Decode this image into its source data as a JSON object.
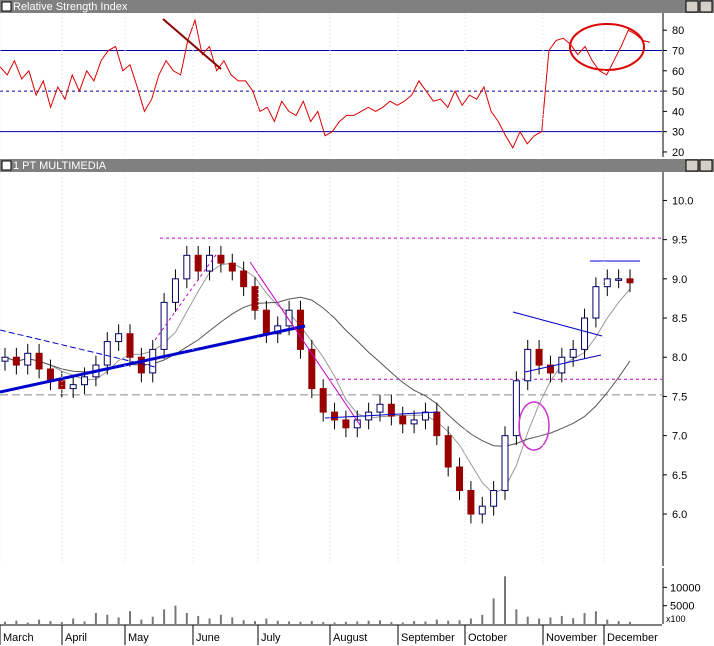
{
  "panels": {
    "rsi_title": "Relative Strength Index",
    "price_title": "1 PT MULTIMEDIA",
    "volume_multiplier": "x100"
  },
  "colors": {
    "title_bar": "#808080",
    "rsi_line": "#dd0000",
    "reference_line": "#0000aa",
    "up_candle": "#ffffff",
    "down_candle": "#990000",
    "trendline_blue": "#0000cc",
    "trendline_magenta": "#cc00cc",
    "ma_short": "#999999",
    "ma_long": "#555555",
    "annotation_red": "#dd0000",
    "annotation_purple": "#cc33cc",
    "volume_bar": "#777777"
  },
  "chart_data": [
    {
      "type": "line",
      "panel": "rsi",
      "title": "Relative Strength Index",
      "ylim": [
        18,
        88
      ],
      "yticks": [
        20,
        30,
        40,
        50,
        60,
        70,
        80
      ],
      "reference_levels": [
        30,
        50,
        70
      ],
      "series": [
        {
          "values": [
            62,
            58,
            65,
            56,
            60,
            48,
            55,
            42,
            52,
            46,
            58,
            50,
            60,
            55,
            65,
            70,
            72,
            60,
            63,
            52,
            40,
            46,
            58,
            65,
            60,
            58,
            75,
            85,
            68,
            72,
            60,
            65,
            58,
            55,
            55,
            50,
            40,
            42,
            35,
            45,
            40,
            38,
            45,
            35,
            40,
            28,
            30,
            35,
            38,
            38,
            40,
            42,
            40,
            42,
            45,
            43,
            45,
            48,
            55,
            50,
            45,
            46,
            42,
            50,
            43,
            48,
            46,
            52,
            40,
            35,
            28,
            22,
            30,
            24,
            28,
            30,
            70,
            75,
            76,
            73,
            68,
            72,
            65,
            60,
            58,
            65,
            72,
            80,
            78,
            75,
            74
          ]
        }
      ]
    },
    {
      "type": "candlestick",
      "panel": "price",
      "title": "1 PT MULTIMEDIA",
      "ylim": [
        5.35,
        10.35
      ],
      "yticks": [
        6.0,
        6.5,
        7.0,
        7.5,
        8.0,
        8.5,
        9.0,
        9.5,
        10.0
      ],
      "x": [
        "March",
        "April",
        "May",
        "June",
        "July",
        "August",
        "September",
        "October",
        "November",
        "December"
      ],
      "closes": [
        8.0,
        7.9,
        8.05,
        7.85,
        7.7,
        7.6,
        7.65,
        7.75,
        7.9,
        8.2,
        8.3,
        8.0,
        7.8,
        8.1,
        8.7,
        9.0,
        9.3,
        9.1,
        9.3,
        9.2,
        9.1,
        8.9,
        8.6,
        8.3,
        8.4,
        8.6,
        8.1,
        7.6,
        7.3,
        7.2,
        7.1,
        7.2,
        7.3,
        7.4,
        7.25,
        7.15,
        7.2,
        7.3,
        7.0,
        6.6,
        6.3,
        6.0,
        6.1,
        6.3,
        7.0,
        7.7,
        8.1,
        7.9,
        7.8,
        8.0,
        8.1,
        8.5,
        8.9,
        9.0,
        9.0,
        8.95
      ]
    },
    {
      "type": "bar",
      "panel": "volume",
      "ylim": [
        0,
        15000
      ],
      "yticks": [
        5000,
        10000
      ],
      "values": [
        600,
        900,
        400,
        1200,
        800,
        500,
        1500,
        700,
        3000,
        2500,
        1800,
        3500,
        1200,
        2000,
        4000,
        5000,
        3000,
        2200,
        1500,
        2500,
        1800,
        1000,
        800,
        1500,
        900,
        700,
        600,
        800,
        500,
        400,
        600,
        700,
        900,
        1000,
        500,
        400,
        800,
        700,
        1200,
        900,
        1000,
        1500,
        2500,
        7000,
        13000,
        4000,
        2000,
        1500,
        1800,
        2200,
        1600,
        3000,
        3500,
        1200,
        800,
        600
      ]
    }
  ]
}
